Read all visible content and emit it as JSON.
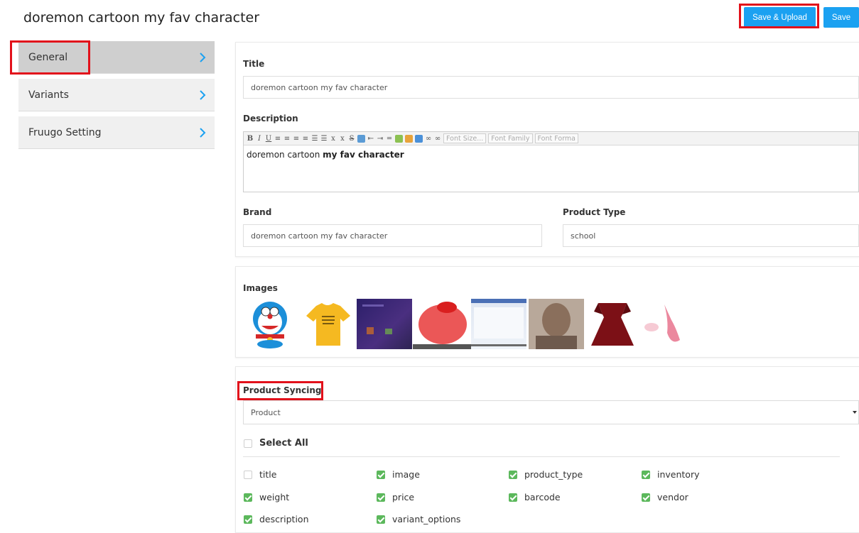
{
  "header": {
    "title": "doremon cartoon my fav character",
    "save_upload_label": "Save & Upload",
    "save_label": "Save"
  },
  "sidebar": {
    "items": [
      {
        "label": "General",
        "active": true
      },
      {
        "label": "Variants",
        "active": false
      },
      {
        "label": "Fruugo Setting",
        "active": false
      }
    ]
  },
  "general": {
    "title_label": "Title",
    "title_value": "doremon cartoon my fav character",
    "description_label": "Description",
    "description_text_plain": "doremon cartoon ",
    "description_text_bold": "my fav character",
    "editor_toolbar": {
      "font_size": "Font Size...",
      "font_family": "Font Family",
      "font_format": "Font Forma"
    },
    "brand_label": "Brand",
    "brand_value": "doremon cartoon my fav character",
    "product_type_label": "Product Type",
    "product_type_value": "school"
  },
  "images": {
    "label": "Images",
    "thumbs": [
      "doraemon-image",
      "yellow-tshirt-image",
      "purple-screenshot-image",
      "red-blurred-image",
      "browser-screenshot-image",
      "blurred-portrait-image",
      "red-dress-image",
      "pink-blurred-image"
    ]
  },
  "syncing": {
    "label": "Product Syncing",
    "selected": "Product",
    "select_all_label": "Select All",
    "fields": [
      {
        "label": "title",
        "checked": false
      },
      {
        "label": "image",
        "checked": true
      },
      {
        "label": "product_type",
        "checked": true
      },
      {
        "label": "inventory",
        "checked": true
      },
      {
        "label": "weight",
        "checked": true
      },
      {
        "label": "price",
        "checked": true
      },
      {
        "label": "barcode",
        "checked": true
      },
      {
        "label": "vendor",
        "checked": true
      },
      {
        "label": "description",
        "checked": true
      },
      {
        "label": "variant_options",
        "checked": true
      }
    ]
  },
  "colors": {
    "accent": "#1ba1f1",
    "highlight": "#e2111b",
    "check": "#5cb85c"
  }
}
